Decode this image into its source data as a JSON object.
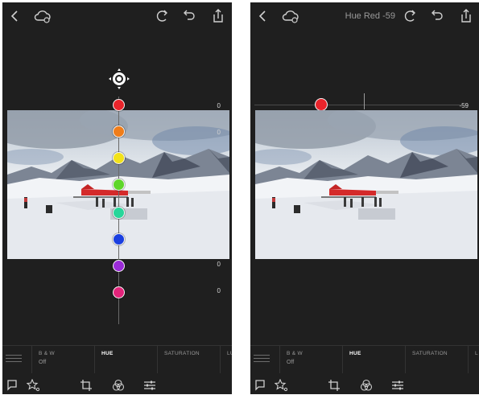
{
  "left": {
    "value_labels": [
      "0",
      "0",
      "0",
      "0"
    ],
    "color_dots": [
      {
        "name": "red",
        "color": "#e8242b"
      },
      {
        "name": "orange",
        "color": "#f07d1a"
      },
      {
        "name": "yellow",
        "color": "#f2e21a"
      },
      {
        "name": "green",
        "color": "#5ed62a"
      },
      {
        "name": "aqua",
        "color": "#27d69a"
      },
      {
        "name": "blue",
        "color": "#1a3fe0"
      },
      {
        "name": "purple",
        "color": "#9b2bd8"
      },
      {
        "name": "magenta",
        "color": "#e2237a"
      }
    ],
    "tabs": [
      {
        "label": "B & W",
        "sub": "Off"
      },
      {
        "label": "HUE",
        "active": true
      },
      {
        "label": "SATURATION"
      },
      {
        "label": "LU"
      }
    ]
  },
  "right": {
    "adjustment_title": "Hue Red -59",
    "slider_value": "-59",
    "slider_color": "#e8242b",
    "tabs": [
      {
        "label": "B & W",
        "sub": "Off"
      },
      {
        "label": "HUE",
        "active": true
      },
      {
        "label": "SATURATION"
      },
      {
        "label": "L"
      }
    ]
  },
  "icons": {
    "top": [
      "back-icon",
      "cloud-sync-icon",
      "redo-icon",
      "undo-icon",
      "share-icon"
    ],
    "bottom": [
      "flag-icon",
      "star-rating-icon",
      "crop-icon",
      "presets-icon",
      "adjustments-icon"
    ]
  }
}
